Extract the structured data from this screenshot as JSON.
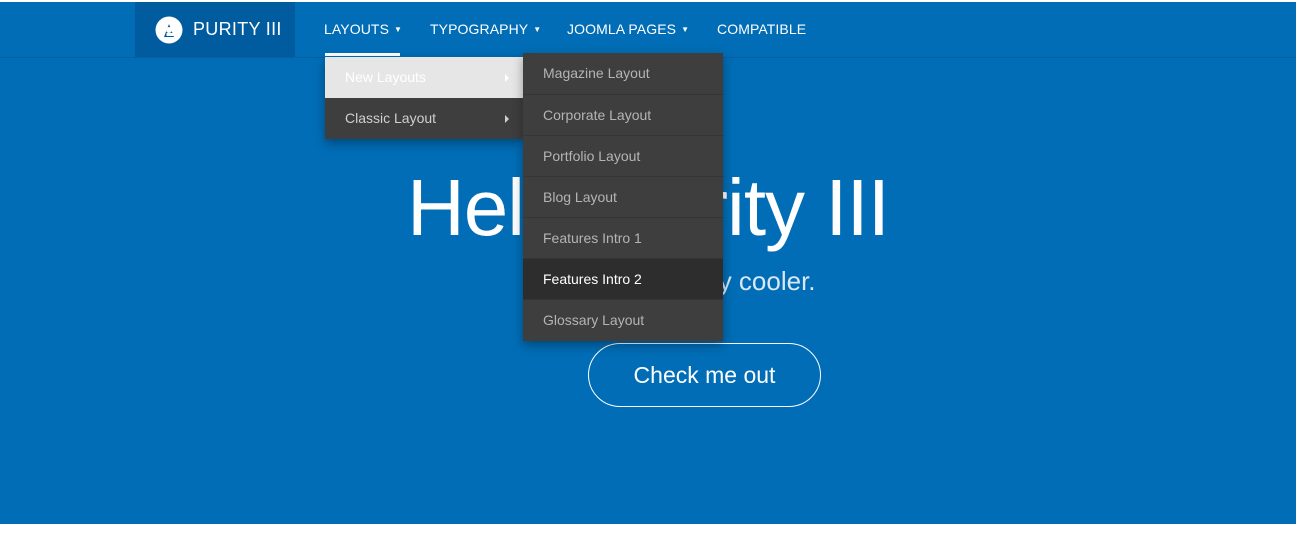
{
  "brand": {
    "name": "PURITY III",
    "logo_icon": "purity-logo-icon"
  },
  "nav": {
    "layouts": "LAYOUTS",
    "typography": "TYPOGRAPHY",
    "joomla_pages": "JOOMLA PAGES",
    "compatible": "COMPATIBLE",
    "caret": "▼"
  },
  "hero": {
    "title": "Hello Purity III",
    "subtitle": "way cooler.",
    "cta": "Check me out"
  },
  "layouts_menu": {
    "items": [
      {
        "label": "New Layouts",
        "active": true
      },
      {
        "label": "Classic Layout",
        "active": false
      }
    ]
  },
  "new_layouts_menu": {
    "items": [
      {
        "label": "Magazine Layout"
      },
      {
        "label": "Corporate Layout"
      },
      {
        "label": "Portfolio Layout"
      },
      {
        "label": "Blog Layout"
      },
      {
        "label": "Features Intro 1"
      },
      {
        "label": "Features Intro 2",
        "active": true
      },
      {
        "label": "Glossary Layout"
      }
    ]
  },
  "colors": {
    "hero_bg": "#006db6",
    "brand_bg": "#005c9e",
    "menu_bg": "#3e3e3e",
    "menu_active": "#2d2d2d"
  }
}
